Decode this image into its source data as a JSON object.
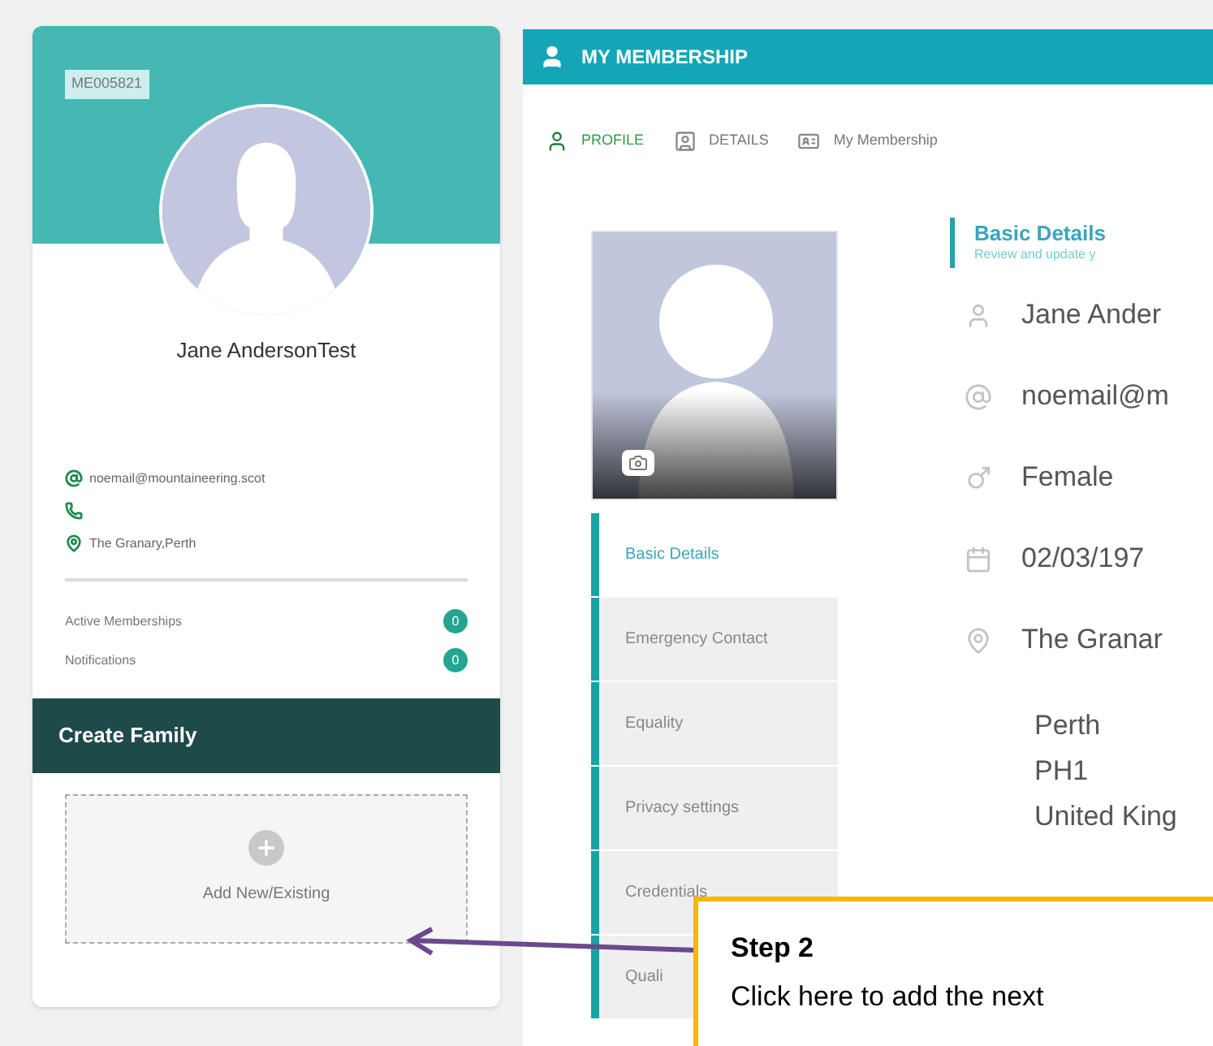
{
  "profile_card": {
    "member_id": "ME005821",
    "name": "Jane AndersonTest",
    "contacts": [
      {
        "kind": "email",
        "text": "noemail@mountaineering.scot"
      },
      {
        "kind": "phone"
      },
      {
        "kind": "location",
        "text": "The Granary,Perth"
      }
    ],
    "stats": [
      {
        "label": "Active Memberships",
        "count": "0"
      },
      {
        "label": "Notifications",
        "count": "0"
      }
    ],
    "family": {
      "title": "Create Family",
      "add_label": "Add New/Existing"
    }
  },
  "panel": {
    "title": "MY MEMBERSHIP",
    "tabs": [
      {
        "label": "PROFILE",
        "kind": "profile",
        "selected": true
      },
      {
        "label": "DETAILS",
        "kind": "details",
        "selected": false
      },
      {
        "label": "My Membership",
        "kind": "card",
        "selected": false
      }
    ],
    "nav": [
      {
        "label": "Basic Details",
        "selected": true
      },
      {
        "label": "Emergency Contact",
        "selected": false
      },
      {
        "label": "Equality",
        "selected": false
      },
      {
        "label": "Privacy settings",
        "selected": false
      },
      {
        "label": "Credentials",
        "selected": false
      },
      {
        "label": "Quali",
        "selected": false
      }
    ],
    "section": {
      "title": "Basic Details",
      "subtitle": "Review and update y"
    },
    "fields": [
      {
        "kind": "person",
        "value": "Jane Ander"
      },
      {
        "kind": "email",
        "value": "noemail@m"
      },
      {
        "kind": "gender",
        "value": "Female"
      },
      {
        "kind": "date",
        "value": "02/03/197"
      },
      {
        "kind": "location",
        "value": "The Granar"
      }
    ],
    "address_lines": [
      "Perth",
      "PH1",
      "United King"
    ]
  },
  "callout": {
    "title": "Step 2",
    "text": "Click here to add the next"
  }
}
